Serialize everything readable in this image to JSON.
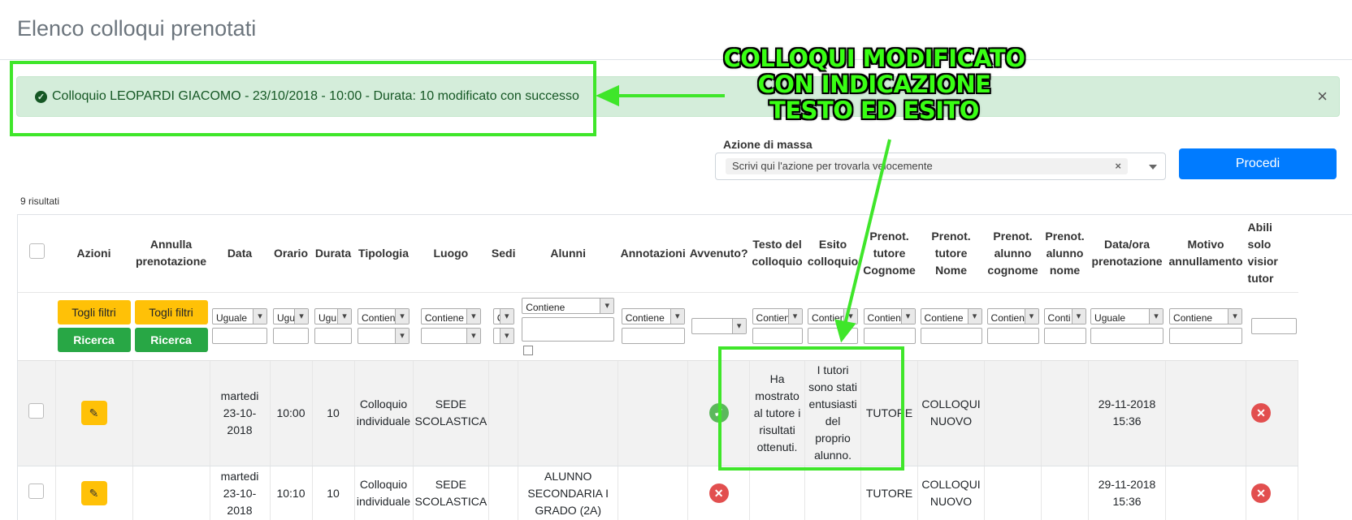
{
  "page": {
    "title": "Elenco colloqui prenotati"
  },
  "alert": {
    "message": "Colloquio LEOPARDI GIACOMO - 23/10/2018 - 10:00 - Durata: 10 modificato con successo",
    "close": "×"
  },
  "mass_action": {
    "label": "Azione di massa",
    "placeholder": "Scrivi qui l'azione per trovarla velocemente",
    "clear": "×",
    "submit": "Procedi"
  },
  "results_count": "9 risultati",
  "table": {
    "headers": {
      "azioni": "Azioni",
      "annulla_1": "Annulla",
      "annulla_2": "prenotazione",
      "data": "Data",
      "orario": "Orario",
      "durata": "Durata",
      "tipologia": "Tipologia",
      "luogo": "Luogo",
      "sedi": "Sedi",
      "alunni": "Alunni",
      "annotazioni": "Annotazioni",
      "avvenuto": "Avvenuto?",
      "testo_1": "Testo del",
      "testo_2": "colloquio",
      "esito_1": "Esito",
      "esito_2": "colloquio",
      "ptc_1": "Prenot.",
      "ptc_2": "tutore",
      "ptc_3": "Cognome",
      "ptn_1": "Prenot.",
      "ptn_2": "tutore",
      "ptn_3": "Nome",
      "pac_1": "Prenot.",
      "pac_2": "alunno",
      "pac_3": "cognome",
      "pan_1": "Prenot.",
      "pan_2": "alunno",
      "pan_3": "nome",
      "dp_1": "Data/ora",
      "dp_2": "prenotazione",
      "motivo_1": "Motivo",
      "motivo_2": "annullamento",
      "abil_1": "Abili",
      "abil_2": "solo",
      "abil_3": "visior",
      "abil_4": "tutor"
    },
    "filters": {
      "togli_filtri": "Togli filtri",
      "ricerca": "Ricerca",
      "uguale": "Uguale",
      "ugu": "Ugu",
      "contiene": "Contiene",
      "contien": "Contien",
      "c": "C",
      "conti": "Conti"
    },
    "rows": [
      {
        "data_1": "martedi",
        "data_2": "23-10-2018",
        "orario": "10:00",
        "durata": "10",
        "tipologia_1": "Colloquio",
        "tipologia_2": "individuale",
        "luogo_1": "SEDE",
        "luogo_2": "SCOLASTICA",
        "avvenuto": "yes",
        "testo_1": "Ha",
        "testo_2": "mostrato",
        "testo_3": "al tutore i",
        "testo_4": "risultati",
        "testo_5": "ottenuti.",
        "esito_1": "I tutori",
        "esito_2": "sono stati",
        "esito_3": "entusiasti",
        "esito_4": "del",
        "esito_5": "proprio",
        "esito_6": "alunno.",
        "tutore_cognome": "TUTORE",
        "tutore_nome_1": "COLLOQUI",
        "tutore_nome_2": "NUOVO",
        "dp_1": "29-11-2018",
        "dp_2": "15:36"
      },
      {
        "data_1": "martedi",
        "data_2": "23-10-2018",
        "orario": "10:10",
        "durata": "10",
        "tipologia_1": "Colloquio",
        "tipologia_2": "individuale",
        "luogo_1": "SEDE",
        "luogo_2": "SCOLASTICA",
        "alunni_1": "ALUNNO",
        "alunni_2": "SECONDARIA I",
        "alunni_3": "GRADO (2A)",
        "avvenuto": "no",
        "tutore_cognome": "TUTORE",
        "tutore_nome_1": "COLLOQUI",
        "tutore_nome_2": "NUOVO",
        "dp_1": "29-11-2018",
        "dp_2": "15:36"
      }
    ]
  },
  "annotation": {
    "line_1": "COLLOQUI MODIFICATO",
    "line_2": "CON INDICAZIONE",
    "line_3": "TESTO ED ESITO",
    "color": "#39ff14"
  }
}
